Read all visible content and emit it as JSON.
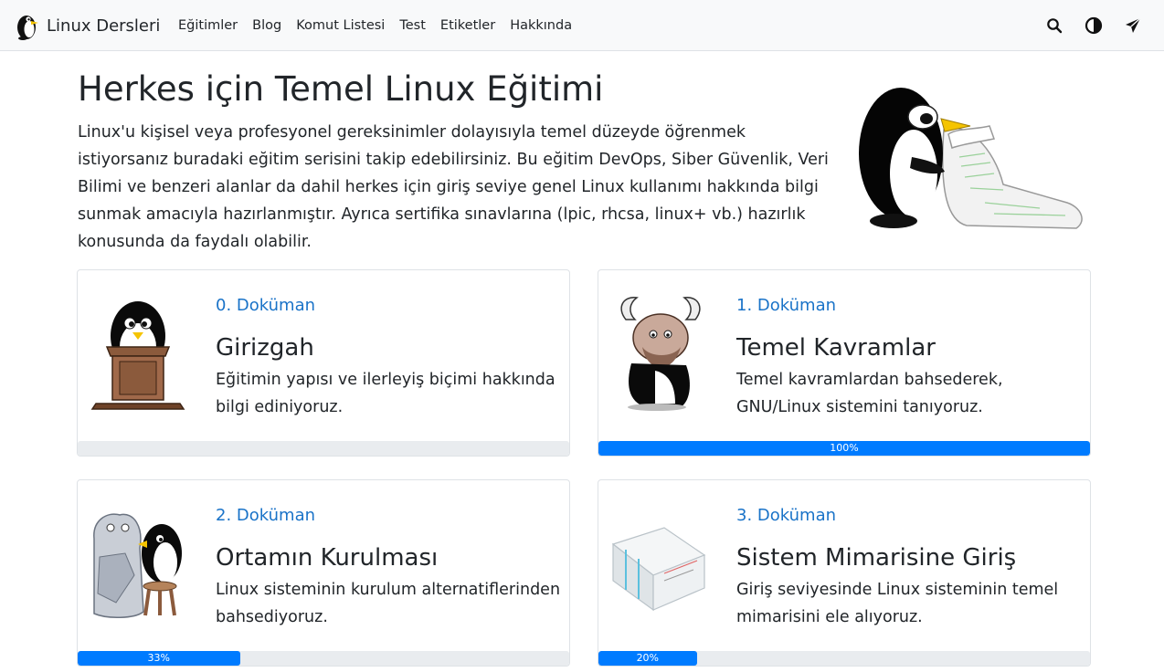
{
  "brand": {
    "name": "Linux Dersleri"
  },
  "nav": {
    "links": [
      "Eğitimler",
      "Blog",
      "Komut Listesi",
      "Test",
      "Etiketler",
      "Hakkında"
    ],
    "icons": [
      "search-icon",
      "contrast-icon",
      "send-icon"
    ]
  },
  "hero": {
    "title": "Herkes için Temel Linux Eğitimi",
    "description": "Linux'u kişisel veya profesyonel gereksinimler dolayısıyla temel düzeyde öğrenmek istiyorsanız buradaki eğitim serisini takip edebilirsiniz. Bu eğitim DevOps, Siber Güvenlik, Veri Bilimi ve benzeri alanlar da dahil herkes için giriş seviye genel Linux kullanımı hakkında bilgi sunmak amacıyla hazırlanmıştır. Ayrıca sertifika sınavlarına (lpic, rhcsa, linux+ vb.) hazırlık konusunda da faydalı olabilir."
  },
  "cards": [
    {
      "number": "0. Doküman",
      "title": "Girizgah",
      "text": "Eğitimin yapısı ve ilerleyiş biçimi hakkında bilgi ediniyoruz.",
      "progress": 0,
      "progress_label": ""
    },
    {
      "number": "1. Doküman",
      "title": "Temel Kavramlar",
      "text": "Temel kavramlardan bahsederek, GNU/Linux sistemini tanıyoruz.",
      "progress": 100,
      "progress_label": "100%"
    },
    {
      "number": "2. Doküman",
      "title": "Ortamın Kurulması",
      "text": "Linux sisteminin kurulum alternatiflerinden bahsediyoruz.",
      "progress": 33,
      "progress_label": "33%"
    },
    {
      "number": "3. Doküman",
      "title": "Sistem Mimarisine Giriş",
      "text": "Giriş seviyesinde Linux sisteminin temel mimarisini ele alıyoruz.",
      "progress": 20,
      "progress_label": "20%"
    }
  ],
  "colors": {
    "accent": "#007bff",
    "link": "#1a73c8",
    "navbar_bg": "#f8f9fa",
    "track": "#e9ecef"
  }
}
